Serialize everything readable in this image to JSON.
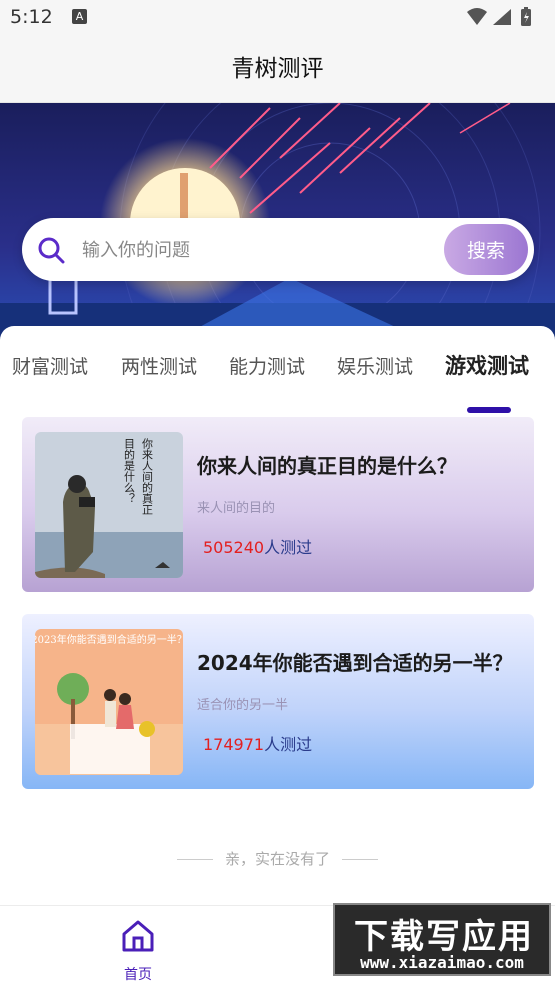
{
  "status_bar": {
    "time": "5:12",
    "notification_icon": "A"
  },
  "header": {
    "title": "青树测评"
  },
  "search": {
    "placeholder": "输入你的问题",
    "button_label": "搜索"
  },
  "tabs": [
    {
      "label": "财富测试",
      "active": false
    },
    {
      "label": "两性测试",
      "active": false
    },
    {
      "label": "能力测试",
      "active": false
    },
    {
      "label": "娱乐测试",
      "active": false
    },
    {
      "label": "游戏测试",
      "active": true
    }
  ],
  "cards": [
    {
      "title": "你来人间的真正目的是什么？",
      "subtitle": "来人间的目的",
      "count": "505240",
      "count_suffix": "人测过",
      "thumb_text_right": "你来人间的真正",
      "thumb_text_left": "目的是什么？"
    },
    {
      "title": "2024年你能否遇到合适的另一半？",
      "subtitle": "适合你的另一半",
      "count": "174971",
      "count_suffix": "人测过",
      "thumb_caption": "2023年你能否遇到合适的另一半？"
    }
  ],
  "end_note": "亲，实在没有了",
  "bottom_nav": {
    "home_label": "首页",
    "home_icon": "home-icon"
  },
  "watermark": {
    "big": "下载写应用",
    "small": "www.xiazaimao.com"
  },
  "colors": {
    "accent": "#4a1fb8",
    "count_red": "#e32020",
    "tab_indicator": "#2e10a8"
  }
}
